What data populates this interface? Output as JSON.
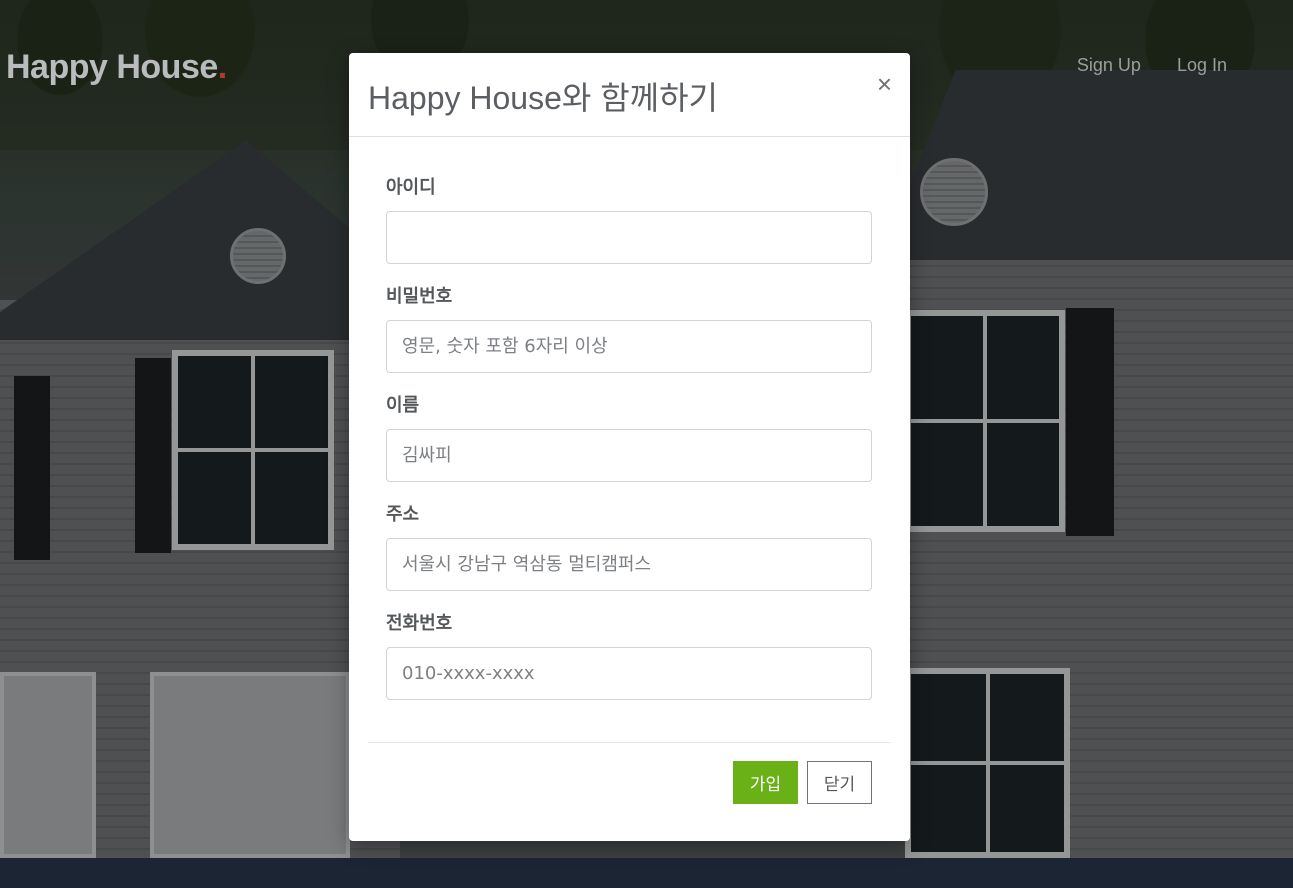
{
  "navbar": {
    "brand": "Happy House",
    "brand_dot": ".",
    "links": [
      "Sign Up",
      "Log In"
    ]
  },
  "modal": {
    "title": "Happy House와 함께하기",
    "close_icon": "close-icon",
    "fields": [
      {
        "label": "아이디",
        "value": "",
        "placeholder": ""
      },
      {
        "label": "비밀번호",
        "value": "",
        "placeholder": "영문, 숫자 포함 6자리 이상"
      },
      {
        "label": "이름",
        "value": "",
        "placeholder": "김싸피"
      },
      {
        "label": "주소",
        "value": "",
        "placeholder": "서울시 강남구 역삼동 멀티캠퍼스"
      },
      {
        "label": "전화번호",
        "value": "",
        "placeholder": "010-xxxx-xxxx"
      }
    ],
    "buttons": {
      "join": "가입",
      "close": "닫기"
    }
  },
  "colors": {
    "join_button": "#6ab117",
    "brand_dot": "#b33a2f",
    "footer": "#1b2533"
  }
}
